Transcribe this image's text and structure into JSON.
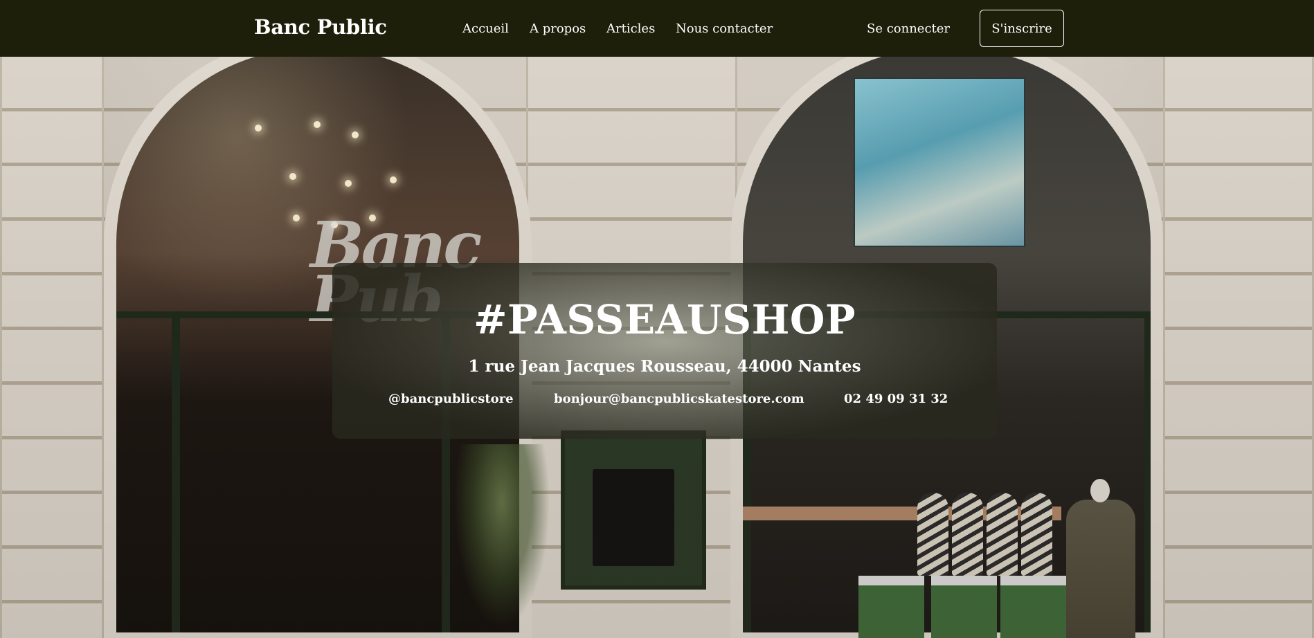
{
  "navbar": {
    "brand": "Banc Public",
    "links": [
      "Accueil",
      "A propos",
      "Articles",
      "Nous contacter"
    ],
    "login_label": "Se connecter",
    "signup_label": "S'inscrire"
  },
  "hero": {
    "headline": "#PASSEAUSHOP",
    "address": "1 rue Jean Jacques Rousseau, 44000 Nantes",
    "instagram": "@bancpublicstore",
    "email": "bonjour@bancpublicskatestore.com",
    "phone": "02 49 09 31 32"
  },
  "colors": {
    "navbar_bg": "#1d1f0b",
    "text": "#ffffff"
  }
}
